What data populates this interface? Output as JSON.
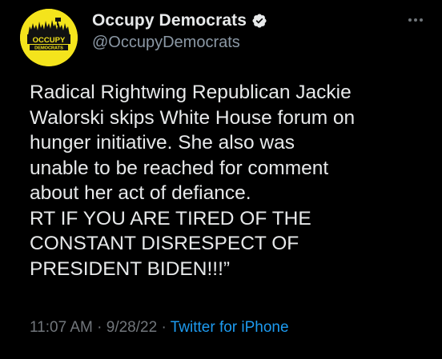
{
  "author": {
    "display_name": "Occupy Democrats",
    "handle": "@OccupyDemocrats",
    "avatar_text_line1": "OCCUPY",
    "avatar_text_line2": "DEMOCRATS",
    "avatar_color": "#f4e41c"
  },
  "tweet": {
    "lines": [
      "Radical Rightwing Republican Jackie",
      "Walorski skips White House forum on",
      "hunger initiative. She also was",
      "unable to be reached for comment",
      "about her act of defiance.",
      "RT IF YOU ARE TIRED OF THE",
      "CONSTANT DISRESPECT OF",
      "PRESIDENT BIDEN!!!”"
    ],
    "time": "11:07 AM",
    "separator": " · ",
    "date": "9/28/22",
    "source": "Twitter for iPhone"
  },
  "colors": {
    "background": "#000000",
    "text": "#e7e9ea",
    "secondary": "#71767b",
    "link": "#1d9bf0",
    "verified": "#e7e9ea"
  },
  "icons": {
    "verified": "verified-badge-icon",
    "more": "more-horizontal-icon"
  }
}
